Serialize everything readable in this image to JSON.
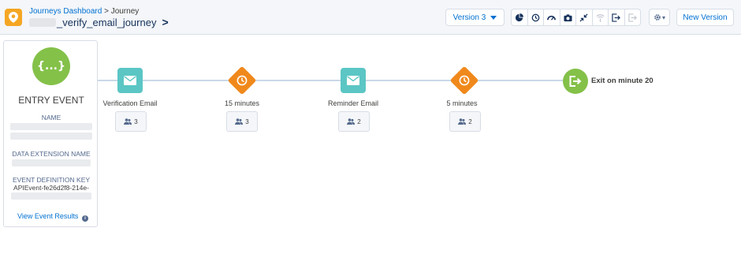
{
  "header": {
    "breadcrumb_link": "Journeys Dashboard",
    "breadcrumb_sep": ">",
    "breadcrumb_current": "Journey",
    "journey_name": "_verify_email_journey",
    "journey_chevron": ">",
    "version_label": "Version 3",
    "new_version_label": "New Version",
    "tools": [
      "chart-icon",
      "history-icon",
      "gauge-icon",
      "camera-icon",
      "collapse-icon",
      "broadcast-icon",
      "exit-icon",
      "exit-disabled-icon"
    ],
    "gear_caret": "▾"
  },
  "entry": {
    "icon_text": "{...}",
    "title": "ENTRY EVENT",
    "name_label": "NAME",
    "data_extension_label": "DATA EXTENSION NAME",
    "event_key_label": "EVENT DEFINITION KEY",
    "event_key_value": "APIEvent-fe26d2f8-214e-",
    "view_results_label": "View Event Results",
    "info_glyph": "i"
  },
  "flow": {
    "steps": [
      {
        "type": "email",
        "label": "Verification Email",
        "count": "3"
      },
      {
        "type": "wait",
        "label": "15 minutes",
        "count": "3"
      },
      {
        "type": "email",
        "label": "Reminder Email",
        "count": "2"
      },
      {
        "type": "wait",
        "label": "5 minutes",
        "count": "2"
      }
    ],
    "exit_label": "Exit on minute 20"
  },
  "colors": {
    "email_node": "#5bc6c4",
    "wait_node": "#f0891c",
    "entry_exit_node": "#84c149",
    "link": "#0070d2",
    "app_icon": "#f5a623"
  }
}
